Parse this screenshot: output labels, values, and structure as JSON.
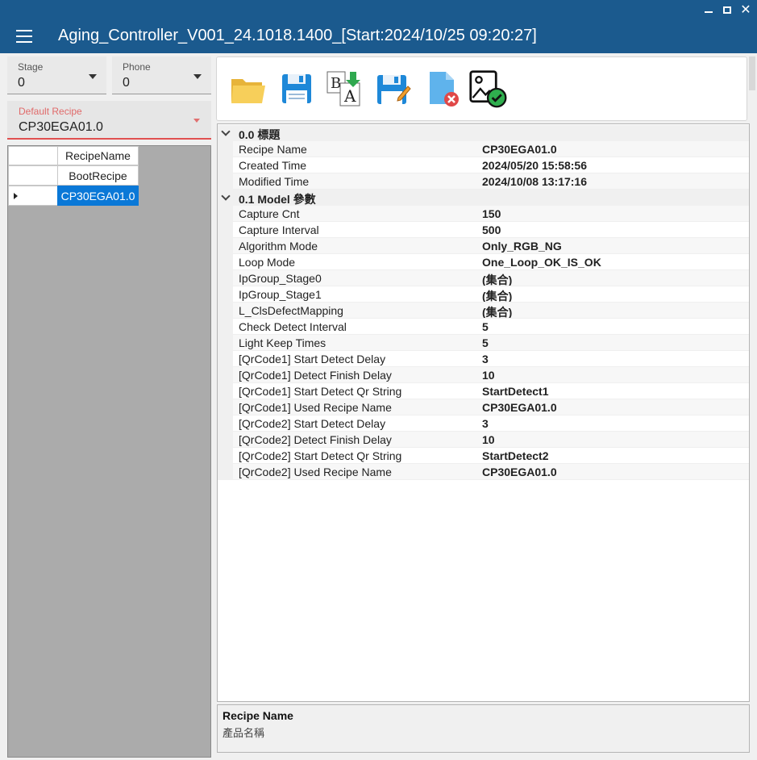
{
  "app": {
    "title": "Aging_Controller_V001_24.1018.1400_[Start:2024/10/25 09:20:27]",
    "window_controls": {
      "minimize": "",
      "maximize": "",
      "close": "✕"
    }
  },
  "stage": {
    "label": "Stage",
    "value": "0"
  },
  "phone": {
    "label": "Phone",
    "value": "0"
  },
  "default_recipe": {
    "label": "Default Recipe",
    "value": "CP30EGA01.0"
  },
  "recipe_grid": {
    "header": "RecipeName",
    "rows": [
      "BootRecipe",
      "CP30EGA01.0"
    ],
    "selected_index": 1
  },
  "toolbar": {
    "icons": [
      "open-folder-icon",
      "save-icon",
      "rename-icon",
      "save-edit-icon",
      "delete-file-icon",
      "image-check-icon"
    ]
  },
  "properties": {
    "categories": [
      {
        "title": "0.0 標題",
        "items": [
          {
            "name": "Recipe Name",
            "value": "CP30EGA01.0"
          },
          {
            "name": "Created Time",
            "value": "2024/05/20 15:58:56"
          },
          {
            "name": "Modified Time",
            "value": "2024/10/08 13:17:16"
          }
        ]
      },
      {
        "title": "0.1 Model 參數",
        "items": [
          {
            "name": "Capture Cnt",
            "value": "150"
          },
          {
            "name": "Capture Interval",
            "value": "500"
          },
          {
            "name": "Algorithm Mode",
            "value": "Only_RGB_NG"
          },
          {
            "name": "Loop Mode",
            "value": "One_Loop_OK_IS_OK"
          },
          {
            "name": "IpGroup_Stage0",
            "value": "(集合)"
          },
          {
            "name": "IpGroup_Stage1",
            "value": "(集合)"
          },
          {
            "name": "L_ClsDefectMapping",
            "value": "(集合)"
          },
          {
            "name": "Check Detect Interval",
            "value": "5"
          },
          {
            "name": "Light Keep Times",
            "value": "5"
          },
          {
            "name": "[QrCode1] Start Detect Delay",
            "value": "3"
          },
          {
            "name": "[QrCode1] Detect Finish Delay",
            "value": "10"
          },
          {
            "name": "[QrCode1] Start Detect Qr String",
            "value": "StartDetect1"
          },
          {
            "name": "[QrCode1] Used Recipe Name",
            "value": "CP30EGA01.0"
          },
          {
            "name": "[QrCode2] Start Detect Delay",
            "value": "3"
          },
          {
            "name": "[QrCode2] Detect Finish Delay",
            "value": "10"
          },
          {
            "name": "[QrCode2] Start Detect Qr String",
            "value": "StartDetect2"
          },
          {
            "name": "[QrCode2] Used Recipe Name",
            "value": "CP30EGA01.0"
          }
        ]
      }
    ]
  },
  "description": {
    "title": "Recipe Name",
    "text": "產品名稱"
  },
  "colors": {
    "titlebar": "#1b5a8e",
    "selection": "#0a78d7",
    "accent_red": "#e05050"
  }
}
